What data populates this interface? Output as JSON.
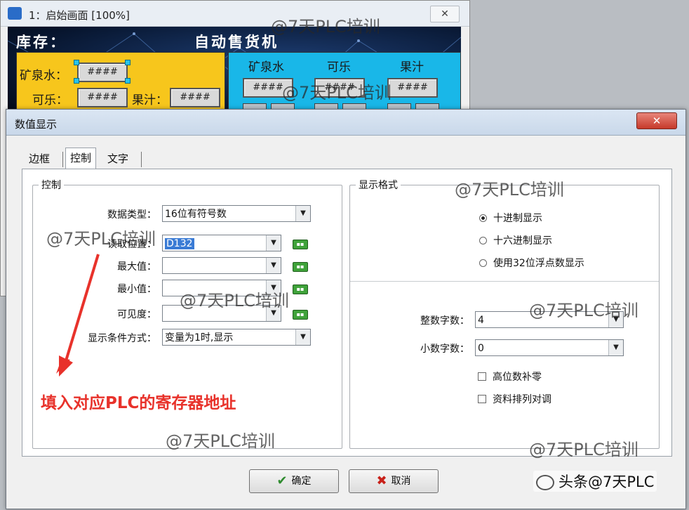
{
  "editor": {
    "title": "1：启始画面 [100%]",
    "close_glyph": "✕",
    "header_left": "库存：",
    "header_center": "自动售货机",
    "stock": {
      "water_label": "矿泉水：",
      "cola_label": "可乐：",
      "juice_label": "果汁：",
      "field_placeholder": "####"
    },
    "vending": {
      "water_label": "矿泉水",
      "cola_label": "可乐",
      "juice_label": "果汁",
      "field_placeholder": "####"
    }
  },
  "dialog": {
    "title": "数值显示",
    "close_glyph": "✕",
    "tabs": [
      "边框",
      "控制",
      "文字"
    ],
    "control_group": {
      "legend": "控制",
      "data_type_label": "数据类型：",
      "data_type_value": "16位有符号数",
      "read_address_label": "读取位置：",
      "read_address_value": "D132",
      "max_label": "最大值：",
      "max_value": "",
      "min_label": "最小值：",
      "min_value": "",
      "visibility_label": "可见度：",
      "visibility_value": "",
      "condition_label": "显示条件方式：",
      "condition_value": "变量为1时,显示"
    },
    "format_group": {
      "legend": "显示格式",
      "radio_decimal": "十进制显示",
      "radio_hex": "十六进制显示",
      "radio_float": "使用32位浮点数显示",
      "int_digits_label": "整数字数：",
      "int_digits_value": "4",
      "dec_digits_label": "小数字数：",
      "dec_digits_value": "0",
      "check_zero_pad": "高位数补零",
      "check_swap": "资料排列对调"
    },
    "ok_label": "确定",
    "cancel_label": "取消"
  },
  "annotation": "填入对应PLC的寄存器地址",
  "watermark": "@7天PLC培训",
  "credit": "头条@7天PLC",
  "colors": {
    "annotation": "#e8322b",
    "stock_panel": "#f7c61c",
    "vending_panel": "#19b7e8",
    "ok_icon": "#2e8b2e",
    "cancel_icon": "#c8211a"
  }
}
